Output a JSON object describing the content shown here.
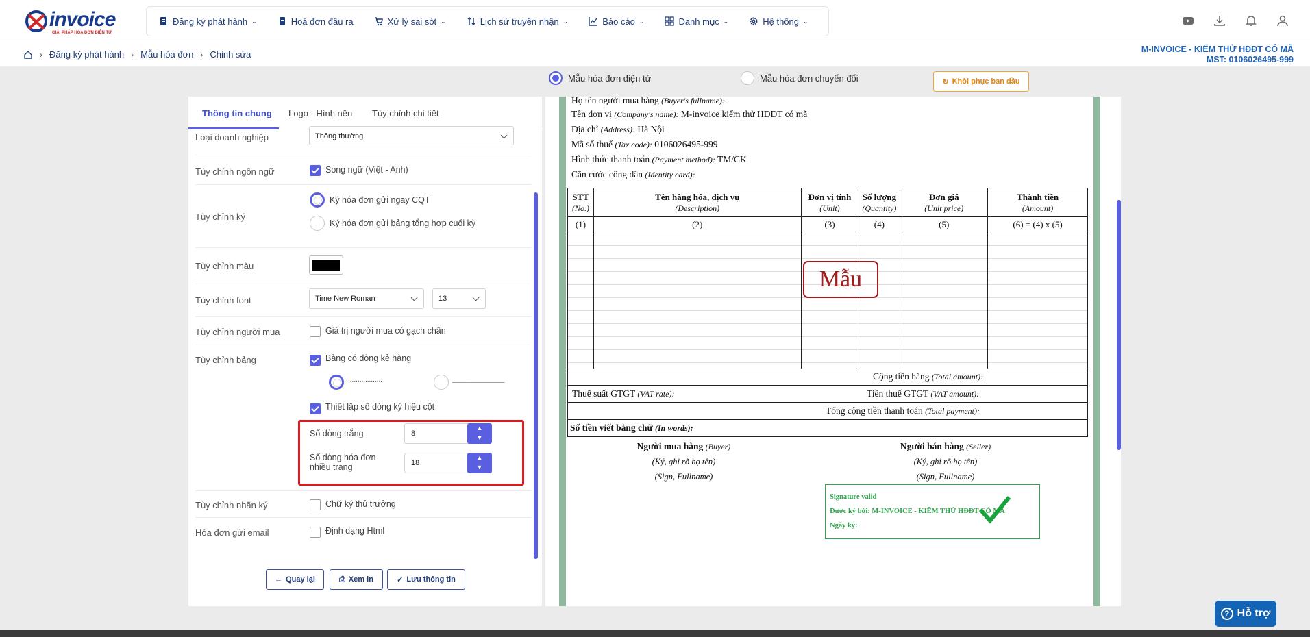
{
  "logo": {
    "text": "invoice",
    "tagline": "GIẢI PHÁP HÓA ĐƠN ĐIỆN TỬ"
  },
  "nav": [
    {
      "label": "Đăng ký phát hành",
      "dropdown": true,
      "icon": "document-icon"
    },
    {
      "label": "Hoá đơn đầu ra",
      "dropdown": false,
      "icon": "file-icon"
    },
    {
      "label": "Xử lý sai sót",
      "dropdown": true,
      "icon": "cart-icon"
    },
    {
      "label": "Lịch sử truyền nhận",
      "dropdown": true,
      "icon": "transfer-icon"
    },
    {
      "label": "Báo cáo",
      "dropdown": true,
      "icon": "chart-icon"
    },
    {
      "label": "Danh mục",
      "dropdown": true,
      "icon": "grid-icon"
    },
    {
      "label": "Hệ thống",
      "dropdown": true,
      "icon": "gear-icon"
    }
  ],
  "breadcrumb": [
    "Đăng ký phát hành",
    "Mẫu hóa đơn",
    "Chỉnh sửa"
  ],
  "company": {
    "name": "M-INVOICE - KIỂM THỬ HĐĐT CÓ MÃ",
    "tax": "MST: 0106026495-999"
  },
  "mode": {
    "electronic": "Mẫu hóa đơn điện tử",
    "converted": "Mẫu hóa đơn chuyển đổi",
    "restore": "Khôi phục ban đầu"
  },
  "tabs": [
    "Thông tin chung",
    "Logo - Hình nền",
    "Tùy chỉnh chi tiết"
  ],
  "form": {
    "business_type_label": "Loại doanh nghiệp",
    "business_type_value": "Thông thường",
    "language_label": "Tùy chỉnh ngôn ngữ",
    "language_option": "Song ngữ (Việt - Anh)",
    "sign_label": "Tùy chỉnh ký",
    "sign_opt1": "Ký hóa đơn gửi ngay CQT",
    "sign_opt2": "Ký hóa đơn gửi bảng tổng hợp cuối kỳ",
    "color_label": "Tùy chỉnh màu",
    "color_value": "#000000",
    "font_label": "Tùy chỉnh font",
    "font_value": "Time New Roman",
    "font_size": "13",
    "buyer_label": "Tùy chỉnh người mua",
    "buyer_option": "Giá trị người mua có gạch chân",
    "table_label": "Tùy chỉnh bảng",
    "table_option": "Bảng có dòng kẻ hàng",
    "line_dotted": "..................",
    "line_solid": "___________",
    "col_option": "Thiết lập số dòng ký hiệu cột",
    "blank_rows_label": "Số dòng trắng",
    "blank_rows_value": "8",
    "multipage_label": "Số dòng hóa đơn nhiều trang",
    "multipage_value": "18",
    "seal_label": "Tùy chỉnh nhãn ký",
    "seal_option": "Chữ ký thủ trưởng",
    "email_label": "Hóa đơn gửi email",
    "email_option": "Định dạng Html"
  },
  "buttons": {
    "back": "Quay lại",
    "print": "Xem in",
    "save": "Lưu thông tin"
  },
  "invoice": {
    "buyer": "Họ tên người mua hàng",
    "buyer_en": "(Buyer's fullname):",
    "company": "Tên đơn vị",
    "company_en": "(Company's name):",
    "company_value": "M-invoice kiểm thử HĐĐT có mã",
    "address": "Địa chỉ",
    "address_en": "(Address):",
    "address_value": "Hà Nội",
    "tax": "Mã số thuế",
    "tax_en": "(Tax code):",
    "tax_value": "0106026495-999",
    "payment": "Hình thức thanh toán",
    "payment_en": "(Payment method):",
    "payment_value": "TM/CK",
    "idcard": "Căn cước công dân",
    "idcard_en": "(Identity card):",
    "columns": [
      {
        "vi": "STT",
        "en": "(No.)",
        "num": "(1)"
      },
      {
        "vi": "Tên hàng hóa, dịch vụ",
        "en": "(Description)",
        "num": "(2)"
      },
      {
        "vi": "Đơn vị tính",
        "en": "(Unit)",
        "num": "(3)"
      },
      {
        "vi": "Số lượng",
        "en": "(Quantity)",
        "num": "(4)"
      },
      {
        "vi": "Đơn giá",
        "en": "(Unit price)",
        "num": "(5)"
      },
      {
        "vi": "Thành tiền",
        "en": "(Amount)",
        "num": "(6) = (4) x (5)"
      }
    ],
    "watermark": "Mẫu",
    "total": "Cộng tiền hàng",
    "total_en": "(Total amount):",
    "vat_rate": "Thuế suất GTGT",
    "vat_rate_en": "(VAT rate):",
    "vat_amount": "Tiền thuế GTGT",
    "vat_amount_en": "(VAT amount):",
    "total_payment": "Tổng cộng tiền thanh toán",
    "total_payment_en": "(Total payment):",
    "words": "Số tiền viết bằng chữ",
    "words_en": "(In words):",
    "buyer_sign": "Người mua hàng",
    "buyer_sign_en": "(Buyer)",
    "seller_sign": "Người bán hàng",
    "seller_sign_en": "(Seller)",
    "sign_hint": "(Ký, ghi rõ họ tên)",
    "sign_hint_en": "(Sign, Fullname)",
    "sig_valid": "Signature valid",
    "sig_by": "Được ký bởi: M-INVOICE - KIỂM THỬ HĐĐT CÓ MÃ",
    "sig_date": "Ngày ký:"
  },
  "support": "Hỗ trợ"
}
